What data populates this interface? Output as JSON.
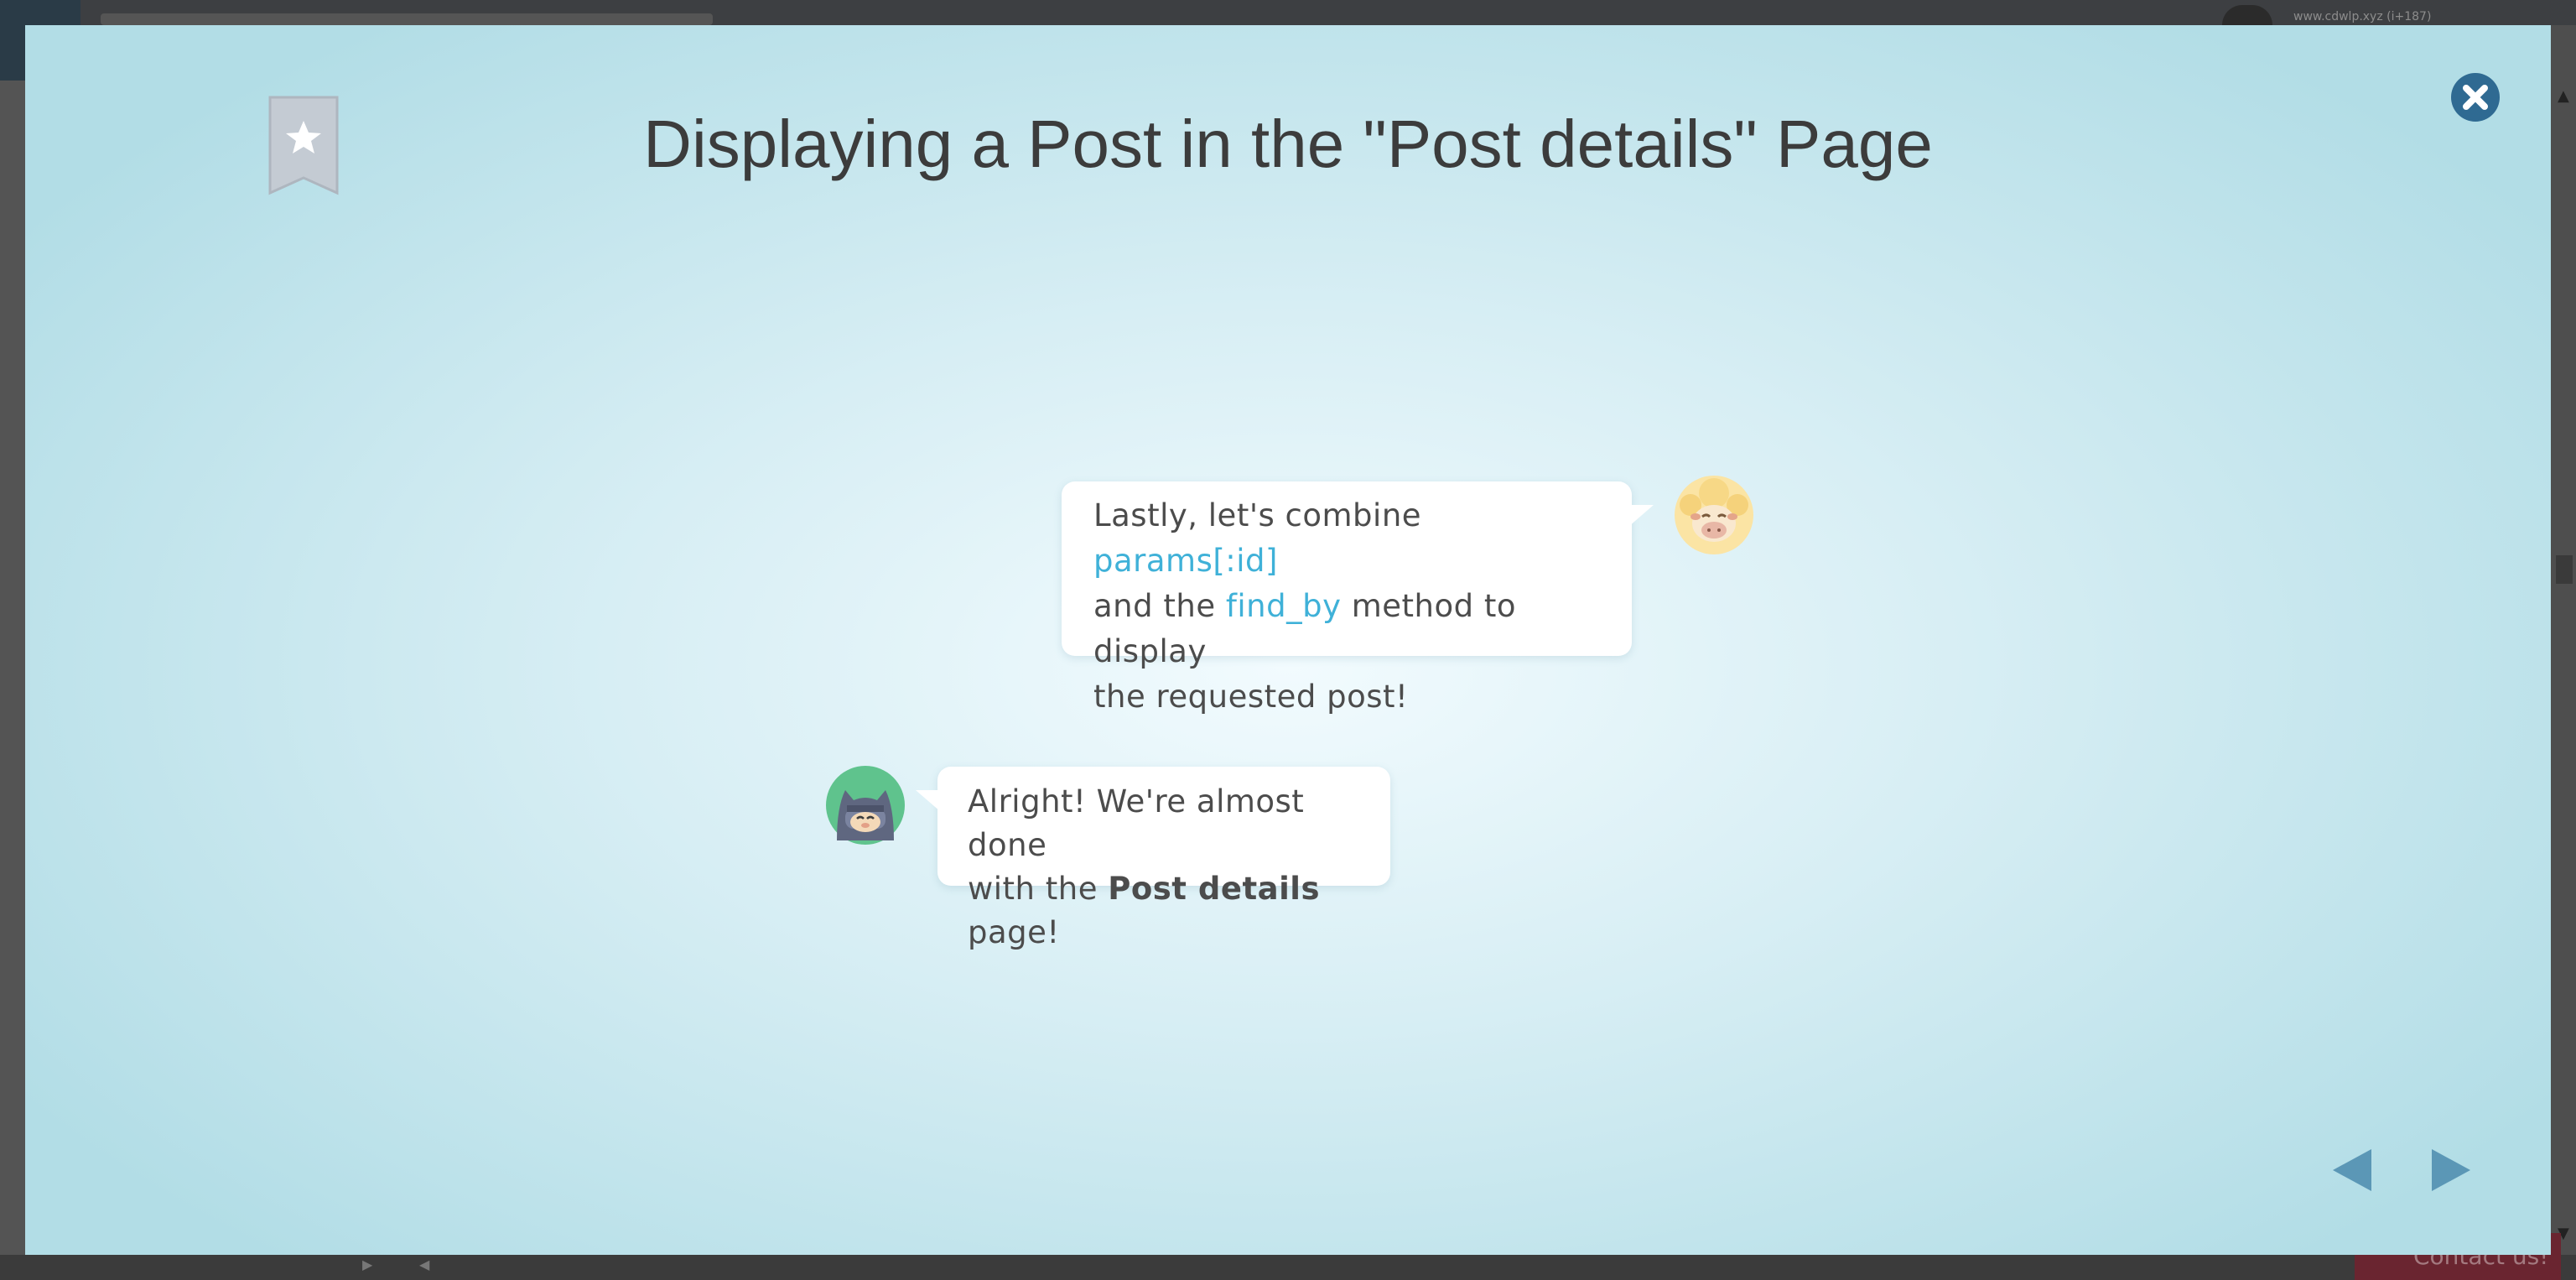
{
  "background": {
    "user_label": "www.cdwlp.xyz (i+187)",
    "contact_label": "Contact us!"
  },
  "modal": {
    "title": "Displaying a Post in the \"Post details\" Page",
    "bookmark_icon": "bookmark-star-icon",
    "close_icon": "close-icon",
    "nav_prev_icon": "triangle-left-icon",
    "nav_next_icon": "triangle-right-icon"
  },
  "dialogue": [
    {
      "speaker": "sheep",
      "line1_prefix": "Lastly, let's combine ",
      "line1_code": "params[:id]",
      "line2_prefix": "and the ",
      "line2_code": "find_by",
      "line2_suffix": " method to display",
      "line3": "the requested post!"
    },
    {
      "speaker": "ninja",
      "line1": "Alright! We're almost done",
      "line2_prefix": "with the ",
      "line2_bold": "Post details",
      "line2_suffix": " page!"
    }
  ],
  "colors": {
    "code": "#3fb1d8",
    "nav_arrow": "#5b97b6",
    "close_button": "#2f6a92",
    "title": "#3c3c3c"
  }
}
